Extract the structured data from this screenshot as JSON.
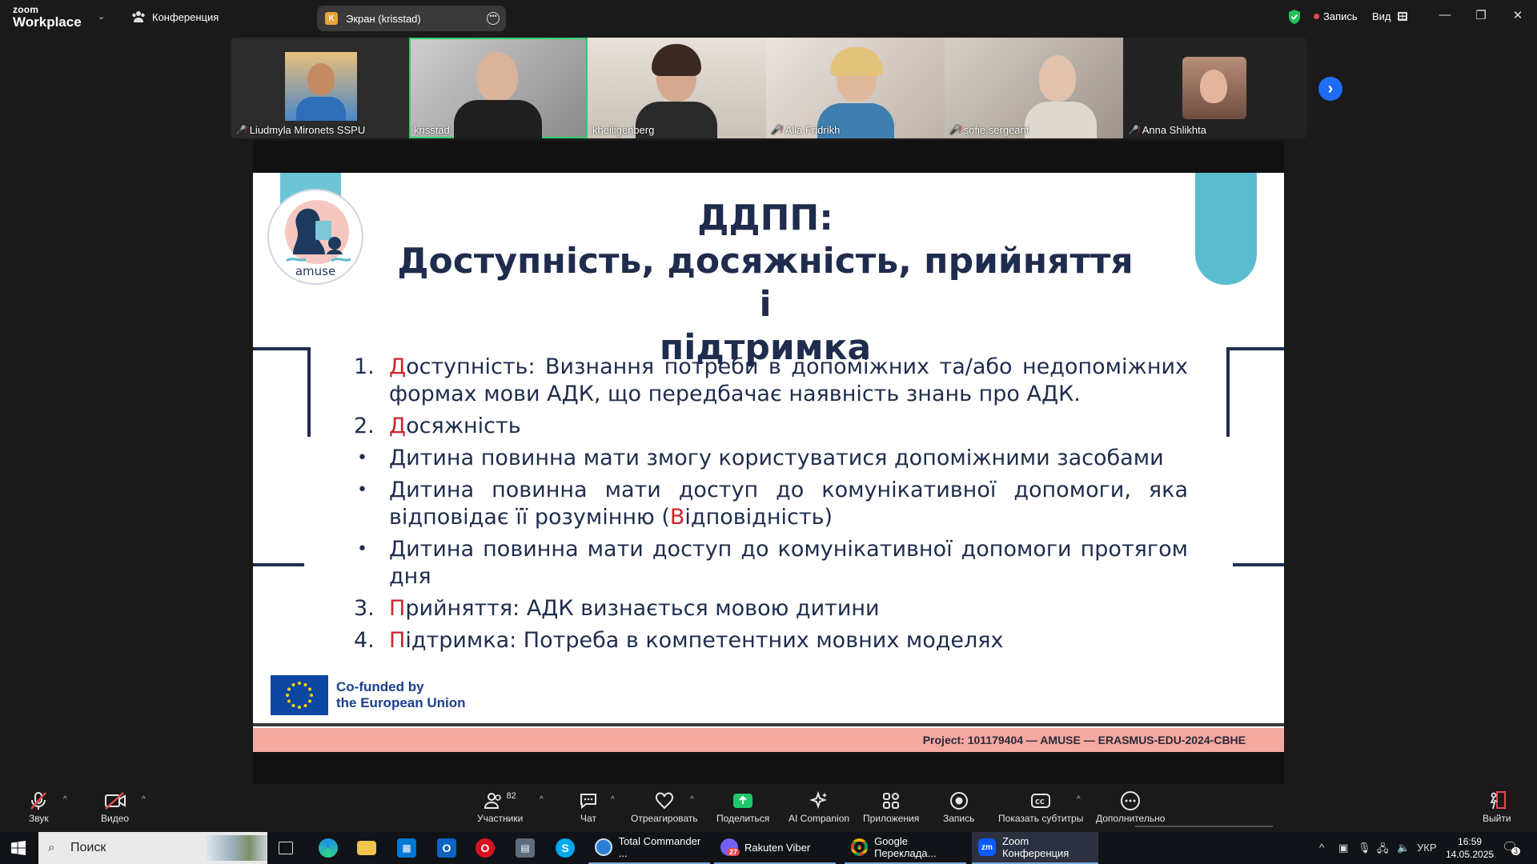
{
  "topbar": {
    "logo_line1": "zoom",
    "logo_line2": "Workplace",
    "conference_label": "Конференция",
    "screen_tab_letter": "K",
    "screen_tab_label": "Экран (krisstad)",
    "record_label": "Запись",
    "view_label": "Вид",
    "record_color": "#e5484d",
    "shield_color": "#21c15a"
  },
  "participants": [
    {
      "name": "Liudmyla Mironets SSPU",
      "muted": true
    },
    {
      "name": "krisstad",
      "muted": false,
      "speaking": true
    },
    {
      "name": "kheiligenberg",
      "muted": false
    },
    {
      "name": "Alla Fridrikh",
      "muted": true
    },
    {
      "name": "sofie.sergeant",
      "muted": true
    },
    {
      "name": "Anna Shlikhta",
      "muted": true
    }
  ],
  "slide": {
    "title_line1": "ДДПП:",
    "title_line2": "Доступність, досяжність, прийняття і",
    "title_line3": "підтримка",
    "logo_text": "amuse",
    "items": [
      {
        "num": "1.",
        "first": "Д",
        "rest": "оступність: Визнання потреби в допоміжних та/або недопоміжних формах мови АДК, що передбачає наявність знань про АДК."
      },
      {
        "num": "2.",
        "first": "Д",
        "rest": "осяжність"
      },
      {
        "num": "•",
        "text": "Дитина повинна мати змогу користуватися допоміжними засобами"
      },
      {
        "num": "•",
        "before": "Дитина повинна мати доступ до комунікативної допомоги, яка відповідає її розумінню (",
        "red": "В",
        "after": "ідповідність)"
      },
      {
        "num": "•",
        "text": "Дитина повинна мати доступ до комунікативної допомоги протягом дня"
      },
      {
        "num": "3.",
        "first": "П",
        "rest": "рийняття: АДК визнається мовою дитини"
      },
      {
        "num": "4.",
        "first": "П",
        "rest": "ідтримка: Потреба в компетентних мовних моделях"
      }
    ],
    "eu_line1": "Co-funded by",
    "eu_line2": "the European Union",
    "footer": "Project: 101179404 — AMUSE — ERASMUS-EDU-2024-CBHE",
    "accent_red": "#d0252b",
    "navy": "#1f2c4d",
    "teal": "#5bbcd0",
    "footer_pink": "#f4a8a0"
  },
  "toolbar": {
    "audio": "Звук",
    "video": "Видео",
    "participants": "Участники",
    "participants_count": "82",
    "chat": "Чат",
    "react": "Отреагировать",
    "share": "Поделиться",
    "ai": "AI Companion",
    "apps": "Приложения",
    "record": "Запись",
    "captions": "Показать субтитры",
    "more": "Дополнительно",
    "leave": "Выйти",
    "share_color": "#1ec769"
  },
  "taskbar": {
    "search_placeholder": "Поиск",
    "apps": [
      {
        "label": "Total Commander ...",
        "icon": "total-commander-icon"
      },
      {
        "label": "Rakuten Viber",
        "badge": "27",
        "icon": "viber-icon"
      },
      {
        "label": "Google Переклада...",
        "icon": "chrome-icon"
      },
      {
        "label": "Zoom Конференция",
        "icon": "zoom-icon",
        "active": true
      }
    ],
    "lang": "УКР",
    "time": "16:59",
    "date": "14.05.2025",
    "notif_count": "3"
  }
}
